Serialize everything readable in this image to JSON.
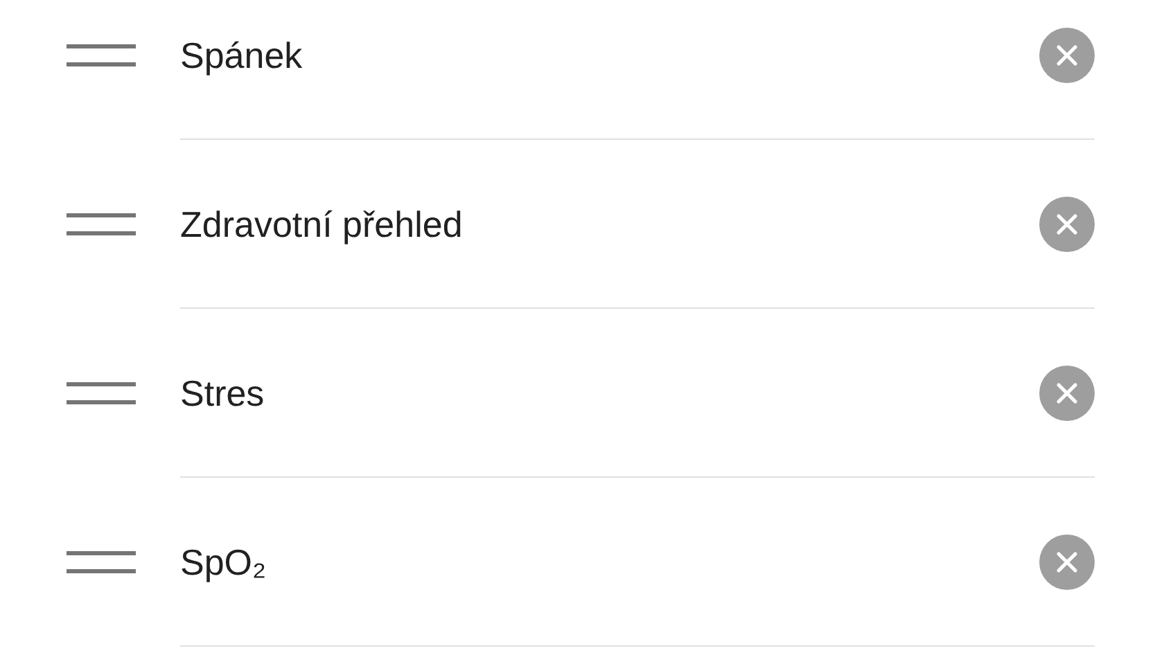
{
  "items": [
    {
      "label": "Spánek"
    },
    {
      "label": "Zdravotní přehled"
    },
    {
      "label": "Stres"
    },
    {
      "label": "SpO₂"
    }
  ]
}
